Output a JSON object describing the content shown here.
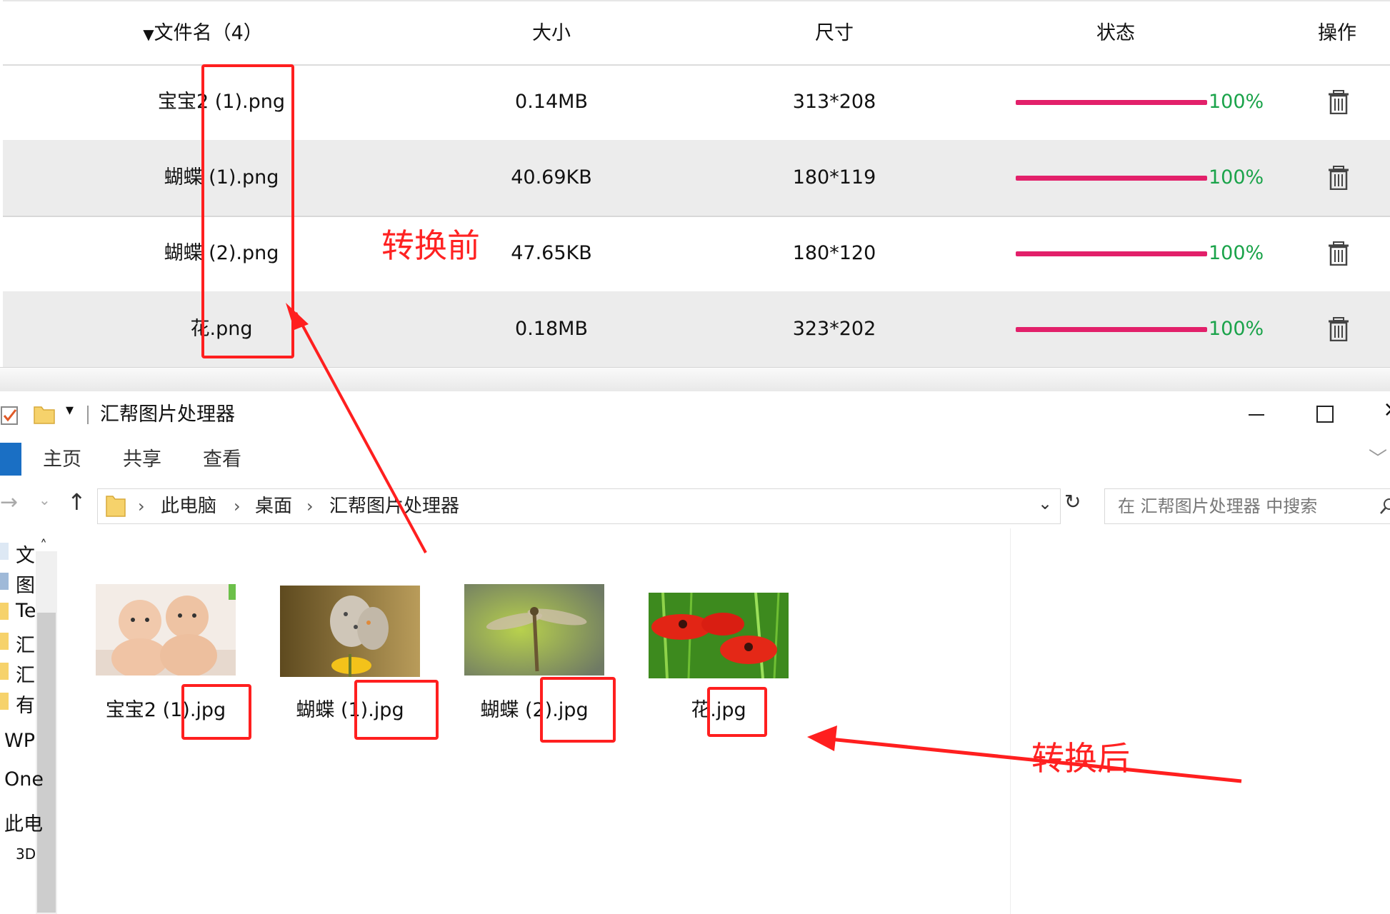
{
  "table": {
    "columns": [
      "文件名（4）",
      "大小",
      "尺寸",
      "状态",
      "操作"
    ],
    "rows": [
      {
        "name": "宝宝2 (1).png",
        "size": "0.14MB",
        "dims": "313*208",
        "progress": 100,
        "status": "100%"
      },
      {
        "name": "蝴蝶 (1).png",
        "size": "40.69KB",
        "dims": "180*119",
        "progress": 100,
        "status": "100%"
      },
      {
        "name": "蝴蝶 (2).png",
        "size": "47.65KB",
        "dims": "180*120",
        "progress": 100,
        "status": "100%"
      },
      {
        "name": "花.png",
        "size": "0.18MB",
        "dims": "323*202",
        "progress": 100,
        "status": "100%"
      }
    ],
    "progress_color": "#e2206a",
    "status_color": "#1aa34a"
  },
  "explorer": {
    "title": "汇帮图片处理器",
    "tabs": [
      "主页",
      "共享",
      "查看"
    ],
    "breadcrumb": [
      "此电脑",
      "桌面",
      "汇帮图片处理器"
    ],
    "search_placeholder": "在 汇帮图片处理器 中搜索",
    "nav_items": [
      "文",
      "图",
      "Te",
      "汇",
      "汇",
      "有",
      "WP",
      "One",
      "此电",
      "3D"
    ],
    "files": [
      {
        "name": "宝宝2 (1).jpg",
        "thumb": "babies"
      },
      {
        "name": "蝴蝶 (1).jpg",
        "thumb": "butterfly"
      },
      {
        "name": "蝴蝶 (2).jpg",
        "thumb": "dragonfly"
      },
      {
        "name": "花.jpg",
        "thumb": "red-flowers"
      }
    ]
  },
  "annotations": {
    "before": "转换前",
    "after": "转换后",
    "color": "#ff1f1f"
  }
}
